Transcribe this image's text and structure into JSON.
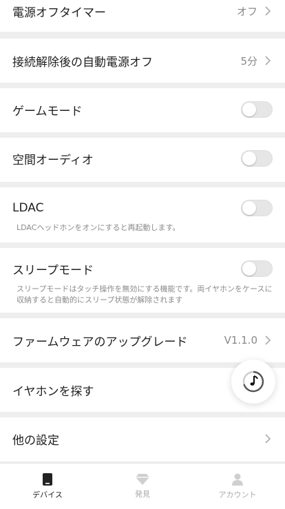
{
  "settings": {
    "power_off_timer": {
      "label": "電源オフタイマー",
      "value": "オフ"
    },
    "auto_power_off": {
      "label": "接続解除後の自動電源オフ",
      "value": "5分"
    },
    "game_mode": {
      "label": "ゲームモード",
      "enabled": false
    },
    "spatial_audio": {
      "label": "空間オーディオ",
      "enabled": false
    },
    "ldac": {
      "label": "LDAC",
      "description": "LDACヘッドホンをオンにすると再起動します。",
      "enabled": false
    },
    "sleep_mode": {
      "label": "スリープモード",
      "description": "スリープモードはタッチ操作を無効にする機能です。両イヤホンをケースに収納すると自動的にスリープ状態が解除されます",
      "enabled": false
    },
    "firmware": {
      "label": "ファームウェアのアップグレード",
      "value": "V1.1.0"
    },
    "find_earbuds": {
      "label": "イヤホンを探す"
    },
    "other_settings": {
      "label": "他の設定"
    }
  },
  "tabbar": {
    "device": "デバイス",
    "discover": "発見",
    "account": "アカウント"
  },
  "colors": {
    "background": "#eeeeee",
    "card": "#ffffff",
    "toggle_off": "#e6e6e6",
    "active_tab": "#222222",
    "inactive_tab": "#aaaaaa"
  }
}
